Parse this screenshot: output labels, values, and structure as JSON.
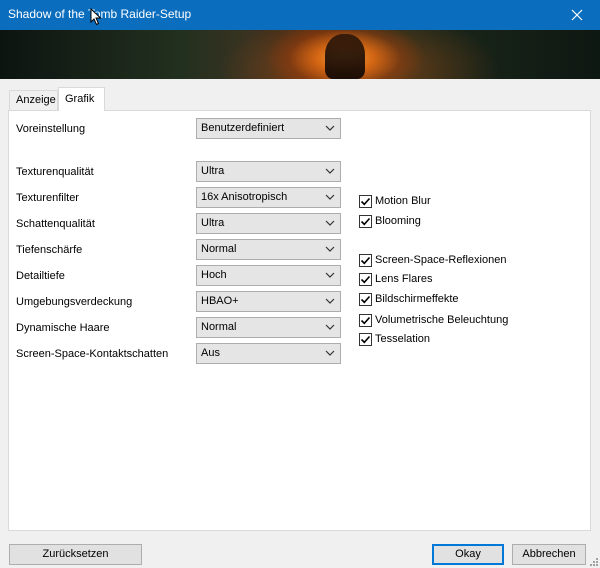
{
  "window": {
    "title": "Shadow of the Tomb Raider-Setup"
  },
  "tabs": [
    {
      "label": "Anzeige"
    },
    {
      "label": "Grafik"
    }
  ],
  "grafik": {
    "preset": {
      "label": "Voreinstellung",
      "value": "Benutzerdefiniert"
    },
    "settings": [
      {
        "label": "Texturenqualität",
        "value": "Ultra"
      },
      {
        "label": "Texturenfilter",
        "value": "16x Anisotropisch"
      },
      {
        "label": "Schattenqualität",
        "value": "Ultra"
      },
      {
        "label": "Tiefenschärfe",
        "value": "Normal"
      },
      {
        "label": "Detailtiefe",
        "value": "Hoch"
      },
      {
        "label": "Umgebungsverdeckung",
        "value": "HBAO+"
      },
      {
        "label": "Dynamische Haare",
        "value": "Normal"
      },
      {
        "label": "Screen-Space-Kontaktschatten",
        "value": "Aus"
      }
    ],
    "checkboxes": [
      {
        "label": "Motion Blur",
        "checked": true
      },
      {
        "label": "Blooming",
        "checked": true
      },
      {
        "label": "Screen-Space-Reflexionen",
        "checked": true
      },
      {
        "label": "Lens Flares",
        "checked": true
      },
      {
        "label": "Bildschirmeffekte",
        "checked": true
      },
      {
        "label": "Volumetrische Beleuchtung",
        "checked": true
      },
      {
        "label": "Tesselation",
        "checked": true
      }
    ]
  },
  "buttons": {
    "reset": "Zurücksetzen",
    "ok": "Okay",
    "cancel": "Abbrechen"
  },
  "colors": {
    "titlebar": "#0b6dbd",
    "focus_border": "#0078d7"
  }
}
